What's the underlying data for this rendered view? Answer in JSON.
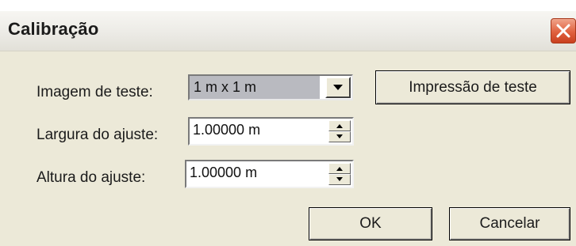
{
  "dialog": {
    "title": "Calibração",
    "close_icon": "close-icon"
  },
  "form": {
    "test_image_label": "Imagem de teste:",
    "test_image_value": "1 m x 1 m",
    "test_print_button": "Impressão de teste",
    "width_label": "Largura do ajuste:",
    "width_value": "1.00000 m",
    "height_label": "Altura do ajuste:",
    "height_value": "1.00000 m"
  },
  "footer": {
    "ok_label": "OK",
    "cancel_label": "Cancelar"
  },
  "colors": {
    "window_bg": "#ece9d8",
    "close_button": "#e0613f",
    "combo_selection": "#b9bac0"
  }
}
